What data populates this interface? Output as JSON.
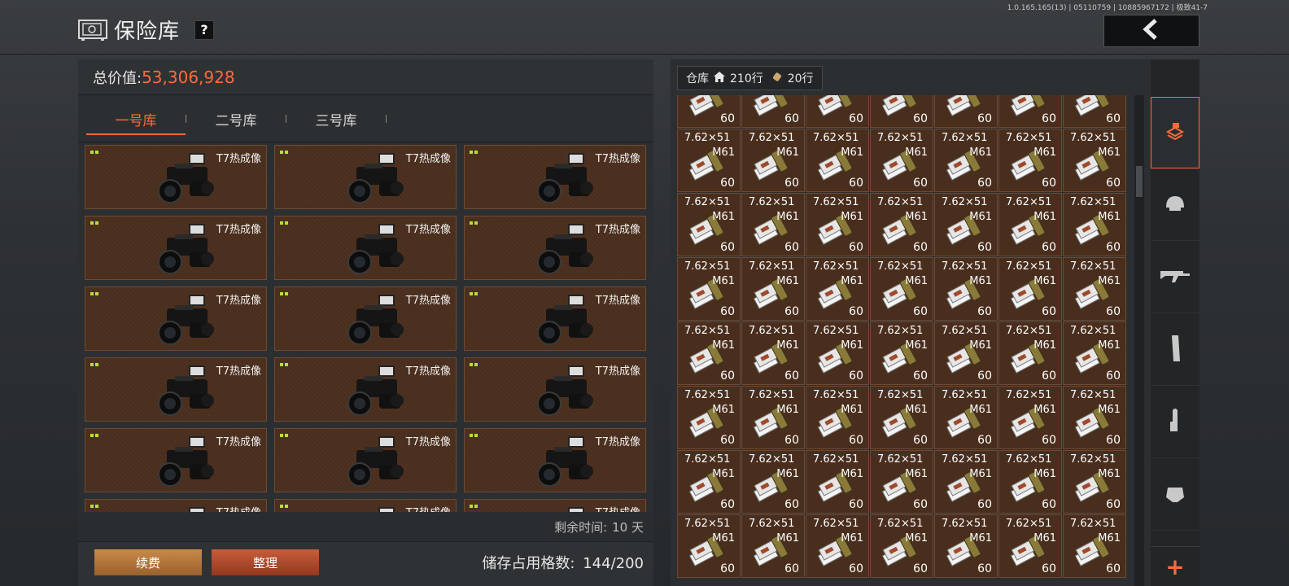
{
  "version": "1.0.165.165(13) | 05110759 | 10885967172 | 极致41-7",
  "header": {
    "title": "保险库",
    "help": "?",
    "back_icon": "chevron-left-icon"
  },
  "left": {
    "total_label": "总价值:",
    "total_value": "53,306,928",
    "tabs": [
      {
        "label": "一号库"
      },
      {
        "label": "二号库"
      },
      {
        "label": "三号库"
      }
    ],
    "items_name": "T7热成像",
    "remaining_label": "剩余时间:",
    "remaining_value": "10 天",
    "renew_label": "续费",
    "sort_label": "整理",
    "storage_label": "储存占用格数:",
    "storage_value": "144/200"
  },
  "right": {
    "warehouse_label": "仓库",
    "rows_home": "210行",
    "rows_ammo": "20行",
    "ammo_caliber": "7.62×51",
    "ammo_model": "M61",
    "ammo_count": "60"
  },
  "colors": {
    "accent": "#ff6a3d",
    "cell_bg": "#4a2e1d",
    "cell_border": "#6e4a33",
    "quality_dot": "#b6e03a"
  },
  "side_nav": [
    "armor-layers-icon",
    "helmet-icon",
    "rifle-icon",
    "magazine-icon",
    "ammo-icon",
    "tactical-rig-icon",
    "add-icon"
  ]
}
